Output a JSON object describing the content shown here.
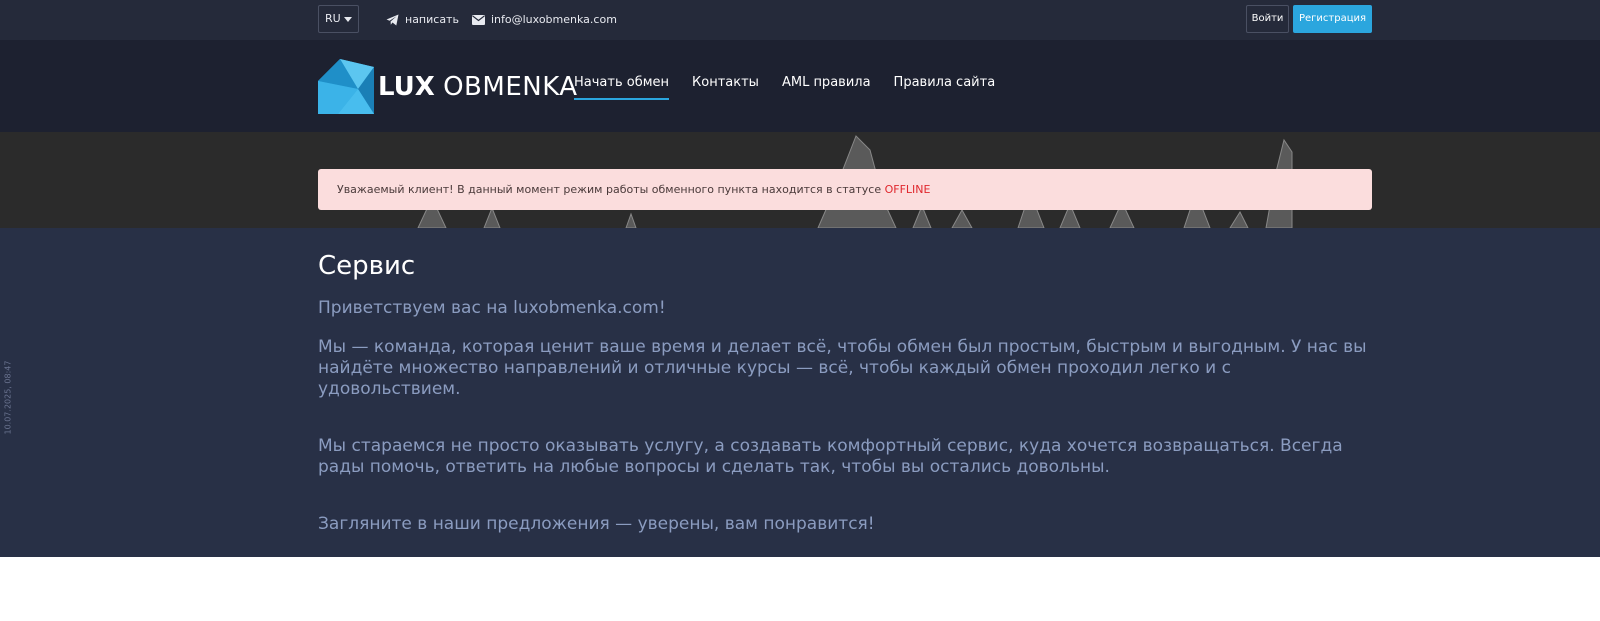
{
  "topbar": {
    "language": "RU",
    "write_label": "написать",
    "email": "info@luxobmenka.com",
    "login_label": "Войти",
    "register_label": "Регистрация"
  },
  "header": {
    "logo_bold": "LUX",
    "logo_light": "OBMENKA",
    "nav": [
      {
        "label": "Начать обмен",
        "active": true
      },
      {
        "label": "Контакты"
      },
      {
        "label": "AML правила"
      },
      {
        "label": "Правила сайта"
      }
    ]
  },
  "alert": {
    "message": "Уважаемый клиент! В данный момент режим работы обменного пункта находится в статусе",
    "status": "OFFLINE"
  },
  "content": {
    "title": "Сервис",
    "paragraphs": [
      "Приветствуем вас на luxobmenka.com!",
      "Мы — команда, которая ценит ваше время и делает всё, чтобы обмен был простым, быстрым и выгодным. У нас вы найдёте множество направлений и отличные курсы — всё, чтобы каждый обмен проходил легко и с удовольствием.",
      "Мы стараемся не просто оказывать услугу, а создавать комфортный сервис, куда хочется возвращаться. Всегда рады помочь, ответить на любые вопросы и сделать так, чтобы вы остались довольны.",
      "Загляните в наши предложения — уверены, вам понравится!"
    ]
  },
  "side_stamp": "10.07.2025, 08:47",
  "colors": {
    "accent": "#2ba6de",
    "topbar_bg": "#252a3a",
    "header_bg": "#1d2130",
    "content_bg": "#283046",
    "alert_bg": "#fbdddd",
    "status_red": "#e0282e"
  }
}
